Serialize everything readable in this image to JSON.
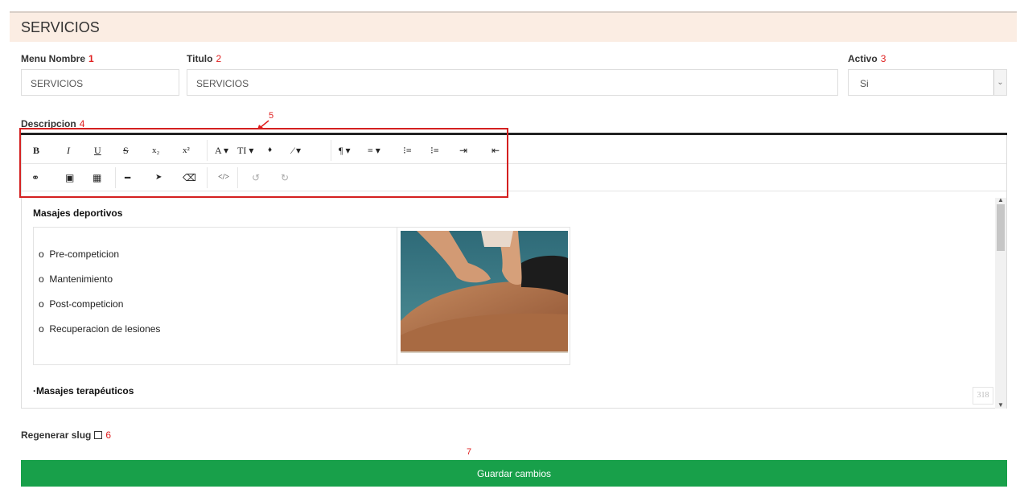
{
  "header": {
    "title": "SERVICIOS"
  },
  "form": {
    "menu_nombre": {
      "label": "Menu Nombre",
      "num": "1",
      "value": "SERVICIOS"
    },
    "titulo": {
      "label": "Titulo",
      "num": "2",
      "value": "SERVICIOS"
    },
    "activo": {
      "label": "Activo",
      "num": "3",
      "value": "Si"
    },
    "descripcion": {
      "label": "Descripcion",
      "num": "4"
    },
    "toolbar_num": "5",
    "regenerar": {
      "label": "Regenerar slug",
      "num": "6"
    },
    "save_num": "7",
    "save_label": "Guardar cambios"
  },
  "toolbar": {
    "row1": [
      {
        "name": "bold-button",
        "glyph": "B"
      },
      {
        "name": "italic-button",
        "glyph": "I"
      },
      {
        "name": "underline-button",
        "glyph": "U"
      },
      {
        "name": "strikethrough-button",
        "glyph": "S"
      },
      {
        "name": "subscript-button",
        "glyph": "x₂"
      },
      {
        "name": "superscript-button",
        "glyph": "x²"
      },
      {
        "name": "font-color-button",
        "glyph": "A ▾"
      },
      {
        "name": "font-size-button",
        "glyph": "TI ▾"
      },
      {
        "name": "fill-color-icon",
        "glyph": "♦"
      },
      {
        "name": "style-button",
        "glyph": "⁄ ▾"
      },
      {
        "name": "paragraph-button",
        "glyph": "¶ ▾"
      },
      {
        "name": "align-button",
        "glyph": "≡ ▾"
      },
      {
        "name": "ordered-list-button",
        "glyph": "⁝≡"
      },
      {
        "name": "unordered-list-button",
        "glyph": "⁝≡"
      },
      {
        "name": "indent-button",
        "glyph": "⇥"
      },
      {
        "name": "outdent-button",
        "glyph": "⇤"
      }
    ],
    "row2": [
      {
        "name": "link-icon",
        "glyph": "⚭"
      },
      {
        "name": "image-icon",
        "glyph": "▣"
      },
      {
        "name": "table-icon",
        "glyph": "▦"
      },
      {
        "name": "horizontal-rule-icon",
        "glyph": "━"
      },
      {
        "name": "select-pointer-icon",
        "glyph": "➤"
      },
      {
        "name": "eraser-icon",
        "glyph": "⌫"
      },
      {
        "name": "code-view-icon",
        "glyph": "</>"
      },
      {
        "name": "undo-icon",
        "glyph": "↺"
      },
      {
        "name": "redo-icon",
        "glyph": "↻"
      }
    ]
  },
  "content": {
    "heading1": "Masajes deportivos",
    "list_items": [
      "Pre-competicion",
      "Mantenimiento",
      "Post-competicion",
      "Recuperacion de lesiones"
    ],
    "heading2": "·Masajes terapéuticos",
    "counter": "318",
    "image_icon": "massage-photo"
  },
  "colors": {
    "header_bg": "#fbede3",
    "annotation_red": "#e02020",
    "save_green": "#18a04a"
  }
}
